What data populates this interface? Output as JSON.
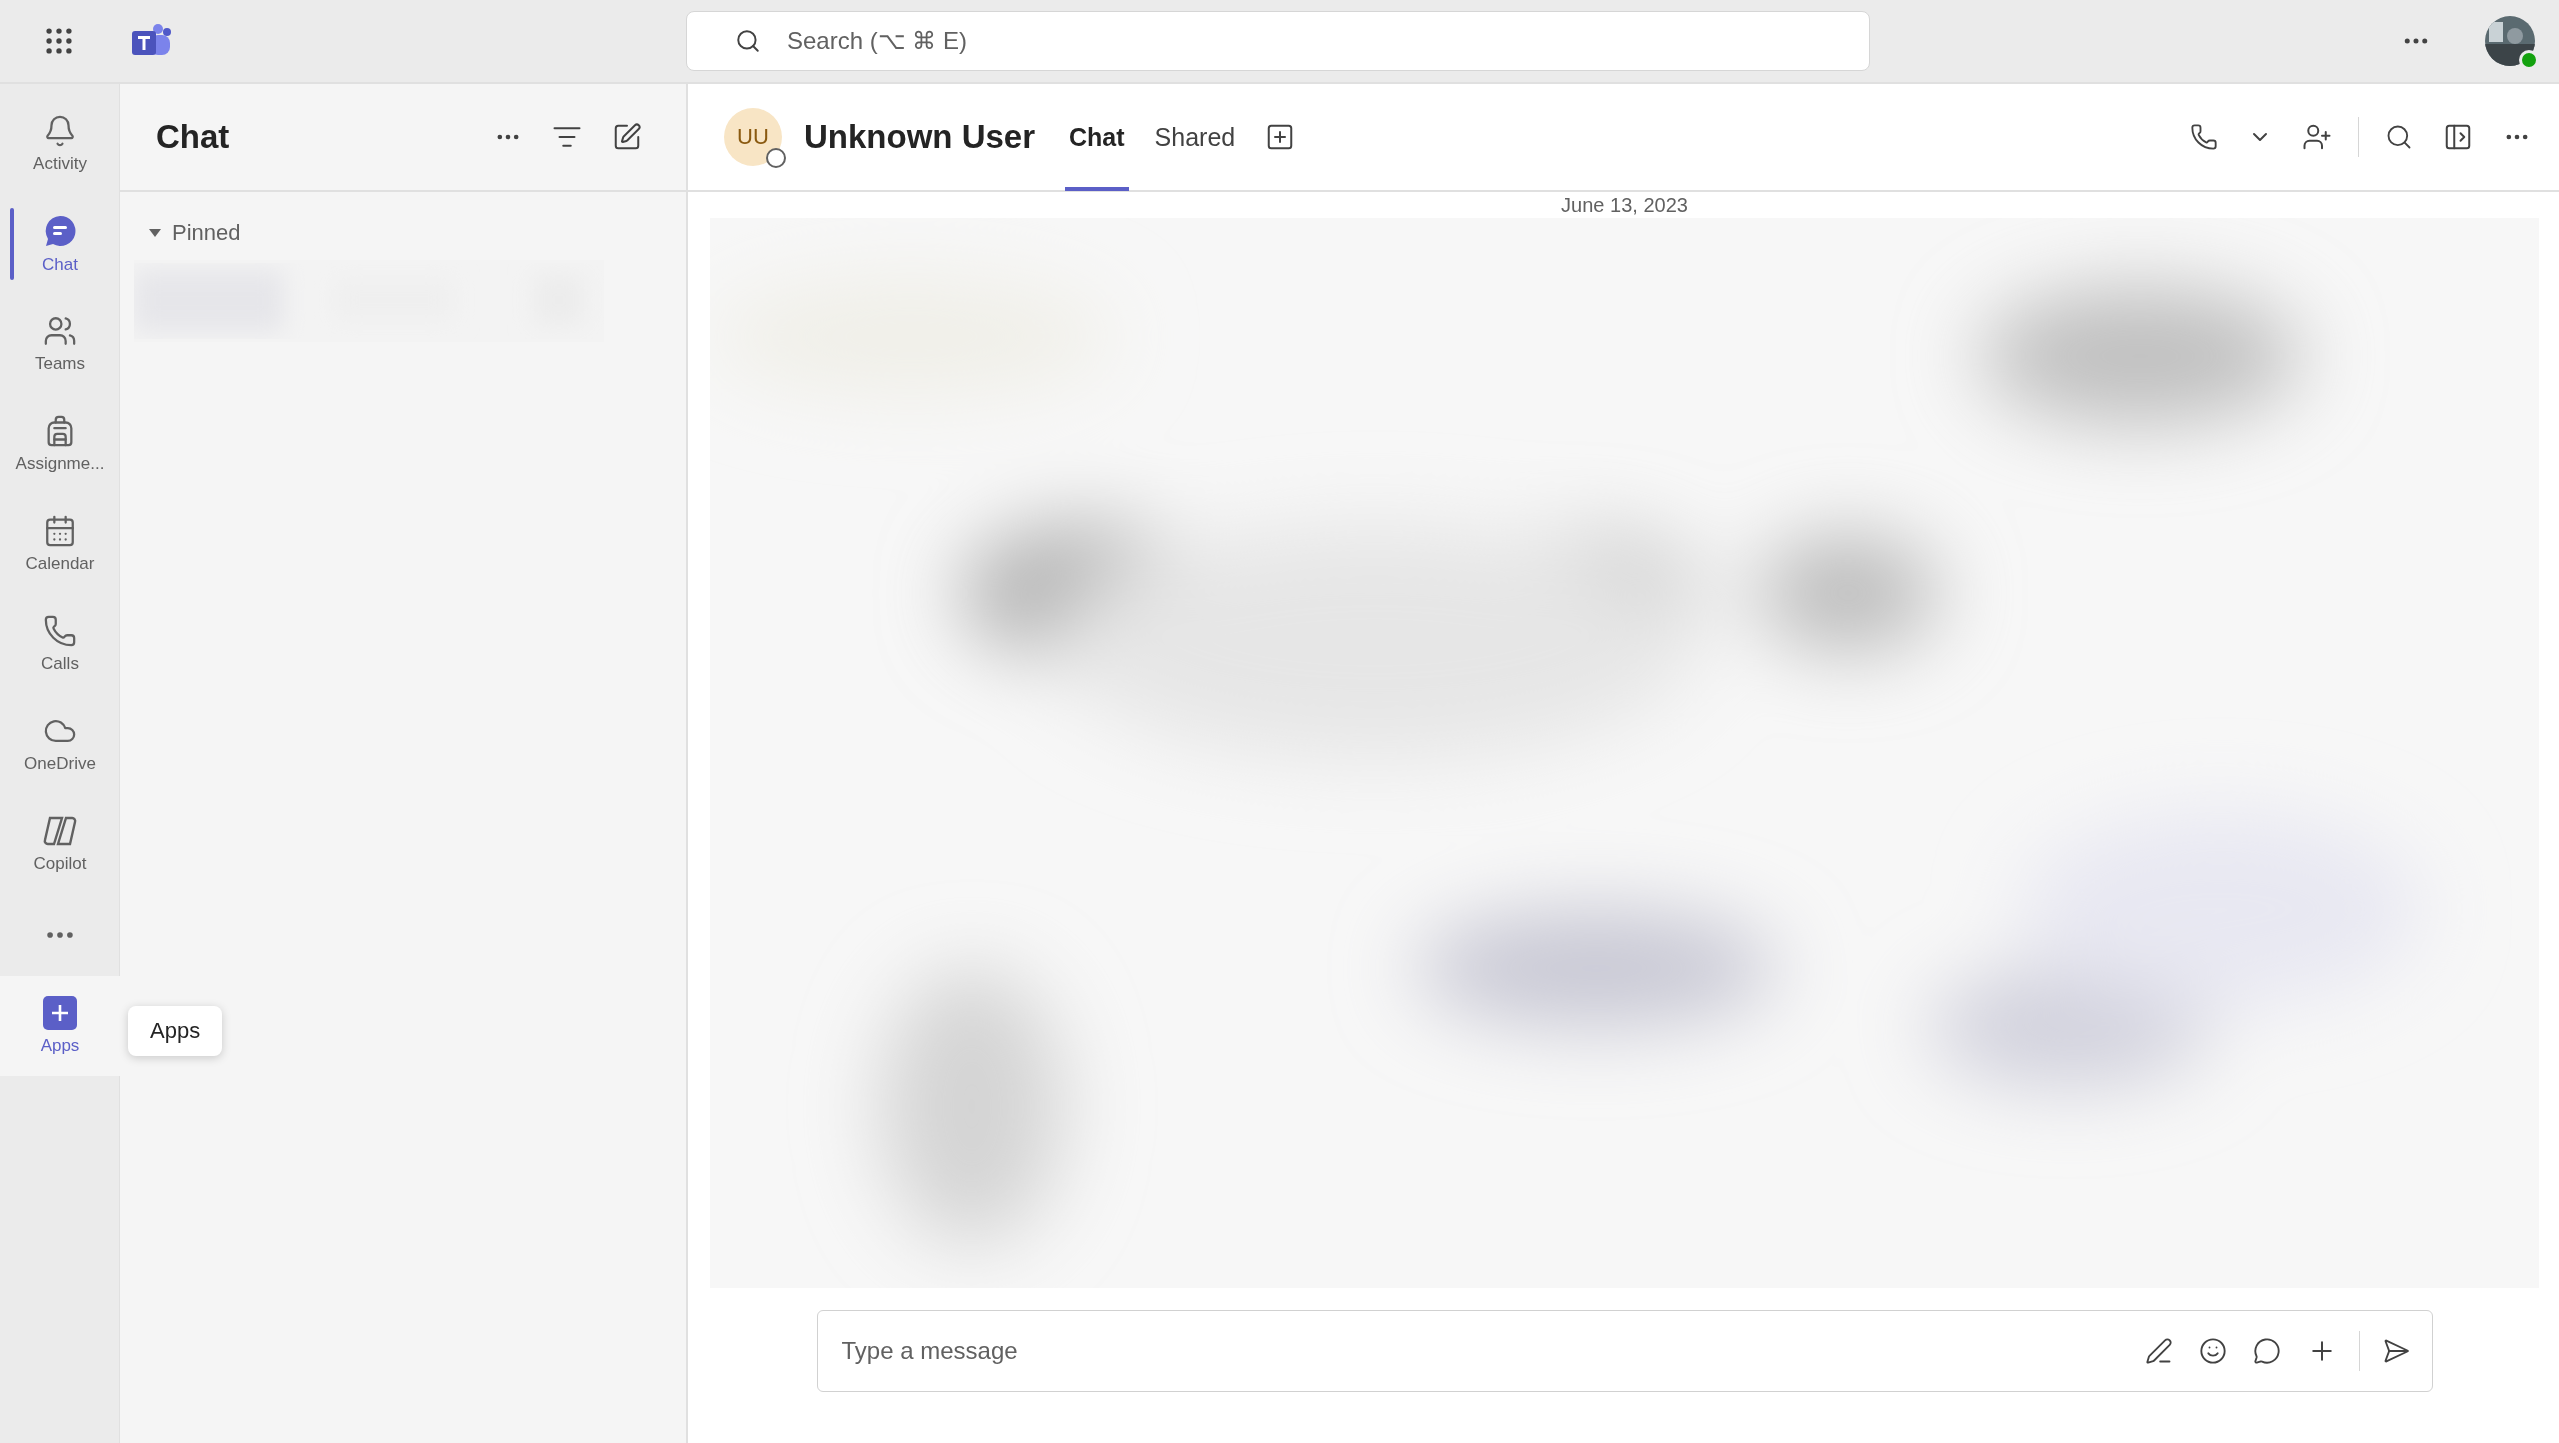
{
  "top_bar": {
    "search": {
      "placeholder": "Search (⌥ ⌘ E)"
    }
  },
  "rail": {
    "items": [
      {
        "kind": "activity",
        "label": "Activity",
        "selected": false,
        "highlighted": false
      },
      {
        "kind": "chat",
        "label": "Chat",
        "selected": true,
        "highlighted": false
      },
      {
        "kind": "teams",
        "label": "Teams",
        "selected": false,
        "highlighted": false
      },
      {
        "kind": "assignments",
        "label": "Assignme...",
        "selected": false,
        "highlighted": false
      },
      {
        "kind": "calendar",
        "label": "Calendar",
        "selected": false,
        "highlighted": false
      },
      {
        "kind": "calls",
        "label": "Calls",
        "selected": false,
        "highlighted": false
      },
      {
        "kind": "onedrive",
        "label": "OneDrive",
        "selected": false,
        "highlighted": false
      },
      {
        "kind": "copilot",
        "label": "Copilot",
        "selected": false,
        "highlighted": false
      }
    ],
    "apps": {
      "label": "Apps",
      "selected": false,
      "highlighted": true
    },
    "tooltip": "Apps"
  },
  "chat_list": {
    "title": "Chat",
    "sections": [
      {
        "label": "Pinned",
        "expanded": true
      }
    ]
  },
  "conversation": {
    "avatar": "UU",
    "name": "Unknown User",
    "tabs": [
      {
        "label": "Chat",
        "selected": true
      },
      {
        "label": "Shared",
        "selected": false
      }
    ],
    "date": "June 13, 2023",
    "composer": {
      "placeholder": "Type a message"
    }
  }
}
